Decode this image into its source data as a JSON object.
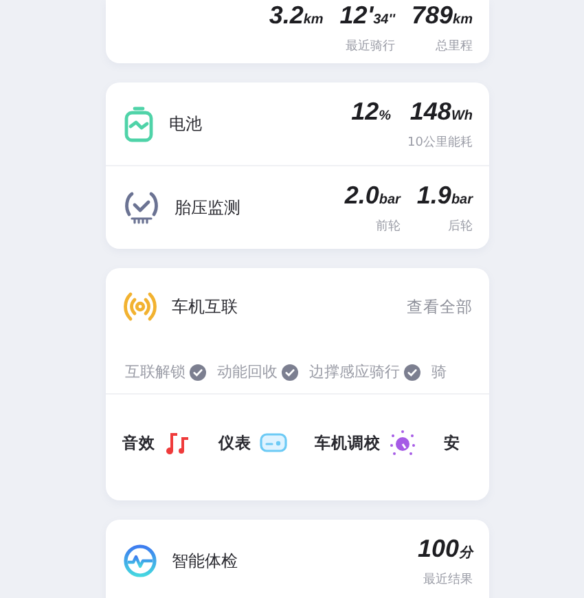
{
  "summary": {
    "stats": [
      {
        "value": "3.2",
        "unit": "km"
      },
      {
        "value": "12'",
        "unit": "34''",
        "caption": "最近骑行"
      },
      {
        "value": "789",
        "unit": "km",
        "caption": "总里程"
      }
    ]
  },
  "status": [
    {
      "kind": "battery",
      "label": "电池",
      "stats": [
        {
          "value": "12",
          "unit": "%"
        },
        {
          "value": "148",
          "unit": "Wh",
          "caption": "10公里能耗"
        }
      ]
    },
    {
      "kind": "tire",
      "label": "胎压监测",
      "stats": [
        {
          "value": "2.0",
          "unit": "bar",
          "caption": "前轮"
        },
        {
          "value": "1.9",
          "unit": "bar",
          "caption": "后轮"
        }
      ]
    }
  ],
  "connect": {
    "title": "车机互联",
    "link": "查看全部",
    "features": [
      {
        "label": "互联解锁",
        "checked": true
      },
      {
        "label": "动能回收",
        "checked": true
      },
      {
        "label": "边撑感应骑行",
        "checked": true
      },
      {
        "label": "骑",
        "checked": false
      }
    ],
    "shortcuts": [
      {
        "label": "音效",
        "kind": "music"
      },
      {
        "label": "仪表",
        "kind": "meter"
      },
      {
        "label": "车机调校",
        "kind": "tune"
      },
      {
        "label": "安"
      }
    ]
  },
  "checkup": {
    "kind": "health",
    "title": "智能体检",
    "stats": [
      {
        "value": "100",
        "unit": "分",
        "caption": "最近结果"
      }
    ]
  }
}
